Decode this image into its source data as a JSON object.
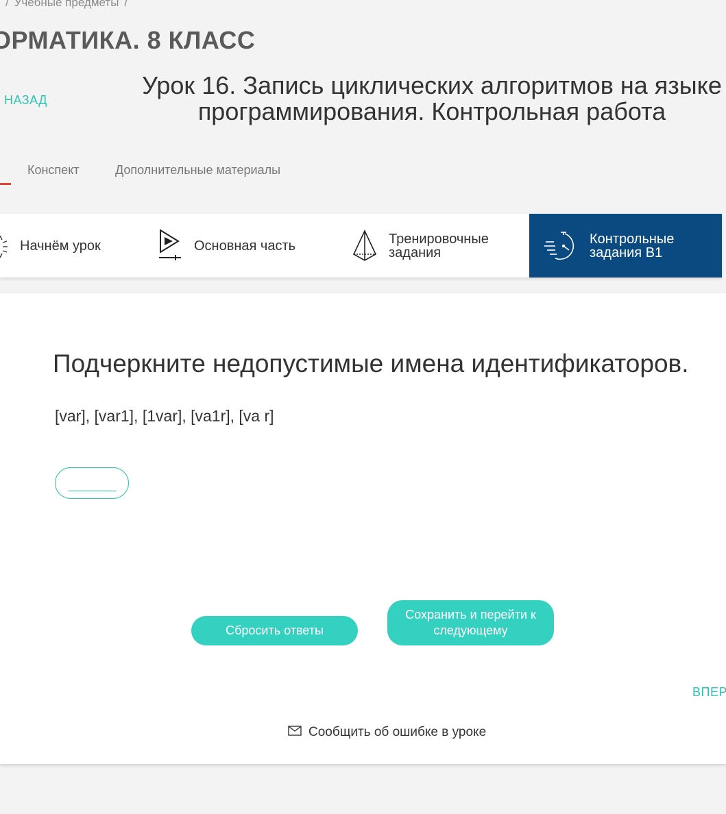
{
  "breadcrumb": {
    "sep1": "/",
    "item": "Учебные предметы",
    "sep2": "/"
  },
  "subject": {
    "title": "ОРМАТИКА. 8 КЛАСС"
  },
  "nav": {
    "back": "НАЗАД",
    "forward": "ВПЕР"
  },
  "lesson": {
    "title": "Урок 16. Запись циклических алгоритмов на языке программирования. Контрольная работа"
  },
  "tabs": [
    {
      "label": "Конспект"
    },
    {
      "label": "Дополнительные материалы"
    }
  ],
  "steps": [
    {
      "label": "Начнём урок",
      "icon": "sun-icon",
      "active": false
    },
    {
      "label": "Основная часть",
      "icon": "play-icon",
      "active": false
    },
    {
      "label_line1": "Тренировочные",
      "label_line2": "задания",
      "icon": "pyramid-icon",
      "active": false
    },
    {
      "label_line1": "Контрольные",
      "label_line2": "задания В1",
      "icon": "stopwatch-icon",
      "active": true
    }
  ],
  "task": {
    "question": "Подчеркните недопустимые имена идентификаторов.",
    "options": "[var], [var1], [1var], [va1r], [va r]"
  },
  "buttons": {
    "reset": "Сбросить ответы",
    "save": "Сохранить и перейти к следующему"
  },
  "report": {
    "label": "Сообщить об ошибке в уроке"
  },
  "colors": {
    "accent": "#34d1c0",
    "active_step": "#0a4a80",
    "tab_marker": "#e0443a"
  }
}
